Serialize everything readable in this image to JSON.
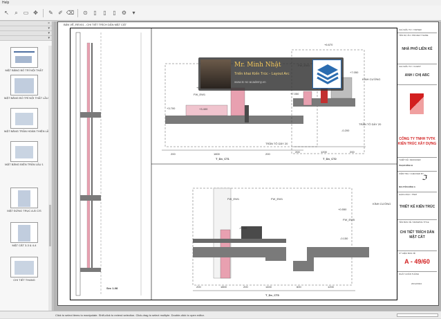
{
  "menubar": {
    "help_label": "Help"
  },
  "toolbar": {
    "buttons": [
      "cursor-icon",
      "zoom-icon",
      "page-icon",
      "plus-icon",
      "pen-icon",
      "search-icon",
      "document-icon",
      "document-icon",
      "document-icon",
      "settings-icon"
    ]
  },
  "sheet": {
    "tab_label": "BẢN VẼ_REV01 - CHI TIẾT TRÍCH DẪN MẶT CẮT"
  },
  "sidebar": {
    "thumbnails": [
      {
        "label": "MẶT BẰNG BỐ TRÍ NỘI THẤT"
      },
      {
        "label": "MẶT BẰNG BỐ TRÍ NỘI THẤT LẦU 1, 2, 3"
      },
      {
        "label": "MẶT BẰNG TRẦN HOÀN THIỆN LẦU 1"
      },
      {
        "label": "MẶT BẰNG ĐIỆN TRẦN LẦU 1"
      },
      {
        "label": "MẶT ĐỨNG TRỤC A-B C/S"
      },
      {
        "label": "MẶT CẮT 3-3 & 4-4"
      },
      {
        "label": "CHI TIẾT THANG"
      }
    ]
  },
  "overlay": {
    "name": "Mr. Minh Nhật",
    "subtitle": "Triển khai Kiến Trúc - Layout Arc",
    "url": "www.tc-sc-academy.vn"
  },
  "drawing": {
    "elev_labels": [
      "+6.670",
      "+7.050",
      "+7.050",
      "+3.700",
      "+3.400",
      "+0.550",
      "-0.050",
      "-0.150",
      "+0.150",
      "-0.200"
    ],
    "notes": [
      "TRẦN TÔ DÀY 20",
      "TRẦN TÔ DÀY 20",
      "KÍNH CƯỜNG",
      "KÍNH CƯỜNG"
    ],
    "fw_labels": [
      "FW_EW1",
      "FW_EW1",
      "FW_EW1",
      "FW_EW1",
      "FW_EW5"
    ],
    "dims_top_left": [
      "200",
      "1800",
      "200"
    ],
    "dims_top_right": [
      "200",
      "1200",
      "200"
    ],
    "dims_bottom": [
      "200",
      "1800",
      "200",
      "1400",
      "600",
      "1200"
    ],
    "section_titles": [
      "T_Dn_CT1",
      "T_Dn_CT2",
      "T_Dn_CT3",
      "Sec 1-08"
    ]
  },
  "titleblock": {
    "owner_caption": "CHỦ ĐẦU TƯ / OWNER",
    "project_caption": "TÊN DỰ ÁN / PROJECT NAME",
    "project_name": "NHÀ PHỐ LIÊN KẾ",
    "client_caption": "CHỦ ĐẦU TƯ / CLIENT",
    "client_name": "ANH / CHỊ ABC",
    "company_name": "CÔNG TY TNHH TVTK KIẾN TRÚC XÂY DỰNG",
    "designer_caption": "THIẾT KẾ / DESIGNER",
    "designer_name": "PHẠM ĐÌNH B",
    "checker_caption": "KIỂM TRA / CHECKED BY",
    "checker_name": "NGUYỄN ĐÌNH A",
    "category_caption": "HẠNG MỤC / ITEM",
    "category": "THIẾT KẾ KIẾN TRÚC",
    "drawing_title_caption": "TÊN BẢN VẼ / DRAWING TITLE",
    "drawing_title": "CHI TIẾT TRÍCH DẪN MẶT CẮT",
    "sheet_no_caption": "KÝ HIỆU BẢN VẼ",
    "sheet_no": "A - 49/60",
    "date_caption": "NGÀY HOÀN THÀNH",
    "date": "20/12/2024"
  },
  "statusbar": {
    "hint": "Click to select items to manipulate. Shift-click to extend selection. Click-drag to select multiple. Double-click to open editor."
  },
  "colors": {
    "concrete": "#7a7a7a",
    "masonry": "#e8a0b0",
    "fill_dark": "#4a4a4a",
    "red": "#d21f1f"
  }
}
